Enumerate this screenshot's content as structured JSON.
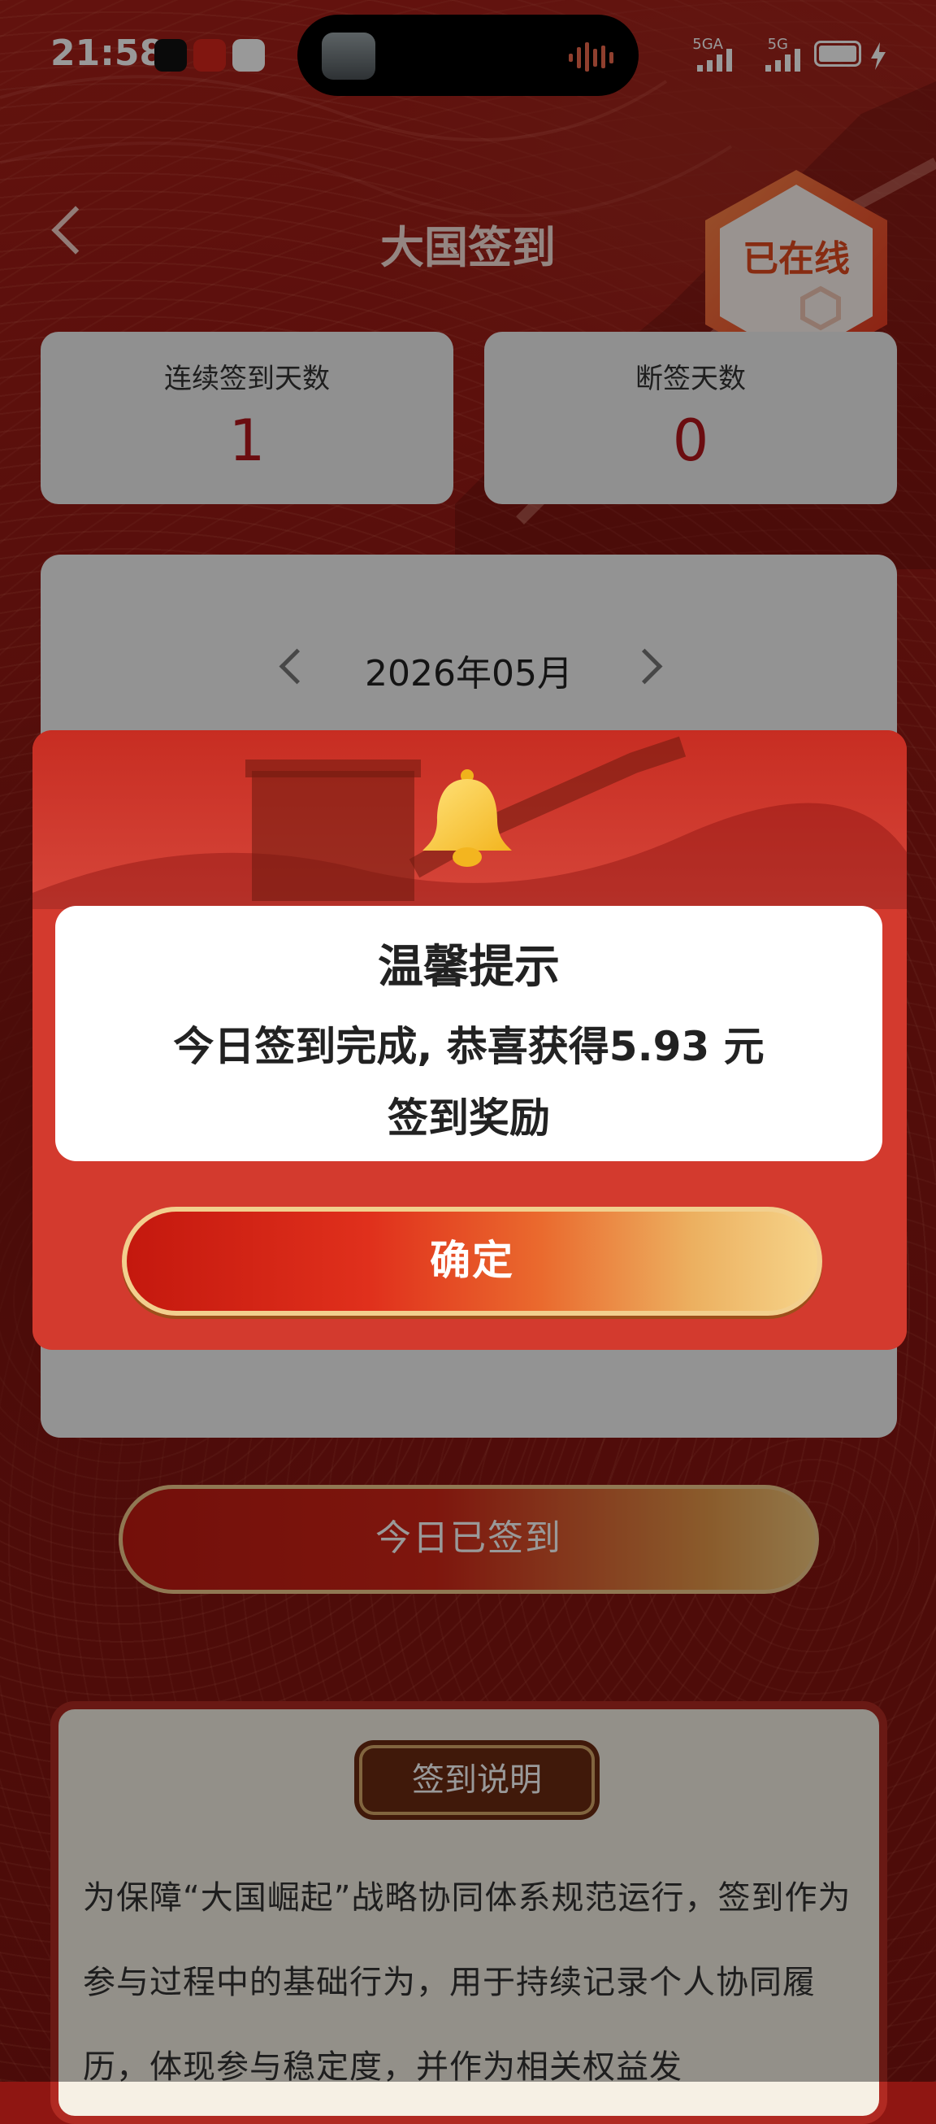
{
  "status": {
    "time": "21:58",
    "signal1": "5GA",
    "signal2": "5G"
  },
  "header": {
    "title": "大国签到",
    "online_badge": "已在线"
  },
  "stats": [
    {
      "label": "连续签到天数",
      "value": "1"
    },
    {
      "label": "断签天数",
      "value": "0"
    }
  ],
  "calendar": {
    "month": "2026年05月"
  },
  "checkin_button": {
    "label": "今日已签到"
  },
  "rules": {
    "tag": "签到说明",
    "text": "为保障“大国崛起”战略协同体系规范运行，签到作为参与过程中的基础行为，用于持续记录个人协同履历，体现参与稳定度，并作为相关权益发"
  },
  "dialog": {
    "title": "温馨提示",
    "message_line1": "今日签到完成, 恭喜获得5.93 元",
    "message_line2": "签到奖励",
    "confirm_label": "确定"
  },
  "colors": {
    "accent_red": "#b3161b",
    "dialog_red": "#d33a2e",
    "gold": "#f2cf8e"
  }
}
